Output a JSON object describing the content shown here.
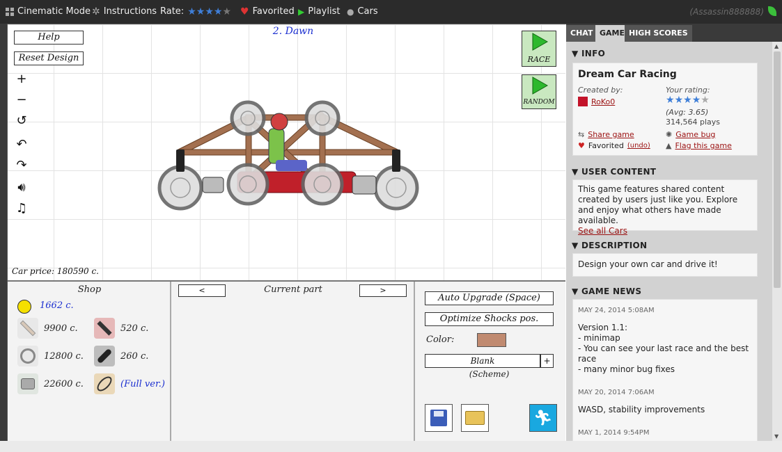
{
  "topbar": {
    "cinematic": "Cinematic Mode",
    "instructions": "Instructions",
    "rate": "Rate:",
    "favorited": "Favorited",
    "playlist": "Playlist",
    "cars": "Cars",
    "username": "(Assassin888888)",
    "rate_stars_filled": 4,
    "rate_stars_total": 5
  },
  "game": {
    "help": "Help",
    "reset": "Reset Design",
    "level": "2. Dawn",
    "race": "RACE",
    "random": "RANDOM",
    "car_price": "Car price: 180590 c.",
    "tools": [
      "zoom-in-icon",
      "zoom-out-icon",
      "rotate-small-icon",
      "undo-icon",
      "redo-icon",
      "sound-icon",
      "music-icon"
    ]
  },
  "shop": {
    "title": "Shop",
    "coins": "1662 c.",
    "items": [
      {
        "name": "beam",
        "price": "9900 c."
      },
      {
        "name": "shock",
        "price": "520 c."
      },
      {
        "name": "wheel",
        "price": "12800 c."
      },
      {
        "name": "chain",
        "price": "260 c."
      },
      {
        "name": "engine",
        "price": "22600 c."
      },
      {
        "name": "wing",
        "price": "(Full ver.)"
      }
    ]
  },
  "part": {
    "prev": "<",
    "label": "Current part",
    "next": ">"
  },
  "controls": {
    "auto_upgrade": "Auto Upgrade (Space)",
    "optimize": "Optimize Shocks pos.",
    "color_label": "Color:",
    "color_value": "#c08a70",
    "scheme_value": "Blank",
    "scheme_plus": "+",
    "scheme_label": "(Scheme)"
  },
  "sidebar": {
    "tabs": [
      "CHAT",
      "GAME",
      "HIGH SCORES"
    ],
    "info_h": "INFO",
    "title": "Dream Car Racing",
    "created_by": "Created by:",
    "author": "RoKo0",
    "your_rating": "Your rating:",
    "avg": "(Avg: 3.65)",
    "plays": "314,564 plays",
    "share": "Share game",
    "bug": "Game bug",
    "favorited": "Favorited",
    "undo": "(undo)",
    "flag": "Flag this game",
    "user_h": "USER CONTENT",
    "user_text": "This game features shared content created by users just like you. Explore and enjoy what others have made available.",
    "see_all": "See all Cars",
    "desc_h": "DESCRIPTION",
    "desc_text": "Design your own car and drive it!",
    "news_h": "GAME NEWS",
    "news": [
      {
        "date": "MAY 24, 2014 5:08AM",
        "lines": [
          "Version 1.1:",
          "- minimap",
          "- You can see your last race and the best race",
          "- many minor bug fixes"
        ]
      },
      {
        "date": "MAY 20, 2014 7:06AM",
        "lines": [
          "WASD, stability improvements"
        ]
      },
      {
        "date": "MAY 1, 2014 9:54PM",
        "lines": []
      }
    ]
  }
}
